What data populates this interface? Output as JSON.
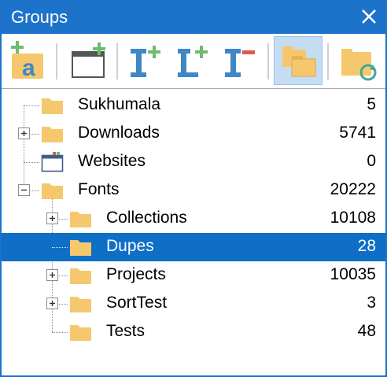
{
  "window": {
    "title": "Groups"
  },
  "toolbar": {
    "buttons": [
      {
        "name": "add-item-icon"
      },
      {
        "name": "new-folder-icon"
      },
      {
        "name": "insert-item-icon"
      },
      {
        "name": "insert-level-icon"
      },
      {
        "name": "remove-item-icon"
      },
      {
        "name": "group-folders-icon",
        "active": true
      },
      {
        "name": "refresh-folder-icon"
      }
    ]
  },
  "tree": {
    "rows": [
      {
        "label": "Sukhumala",
        "count": "5",
        "level": 0,
        "expander": "none",
        "icon": "folder"
      },
      {
        "label": "Downloads",
        "count": "5741",
        "level": 0,
        "expander": "plus",
        "icon": "folder"
      },
      {
        "label": "Websites",
        "count": "0",
        "level": 0,
        "expander": "none",
        "icon": "website"
      },
      {
        "label": "Fonts",
        "count": "20222",
        "level": 0,
        "expander": "minus",
        "icon": "folder"
      },
      {
        "label": "Collections",
        "count": "10108",
        "level": 1,
        "expander": "plus",
        "icon": "folder"
      },
      {
        "label": "Dupes",
        "count": "28",
        "level": 1,
        "expander": "none",
        "icon": "folder",
        "selected": true
      },
      {
        "label": "Projects",
        "count": "10035",
        "level": 1,
        "expander": "plus",
        "icon": "folder"
      },
      {
        "label": "SortTest",
        "count": "3",
        "level": 1,
        "expander": "plus",
        "icon": "folder"
      },
      {
        "label": "Tests",
        "count": "48",
        "level": 1,
        "expander": "none",
        "icon": "folder"
      }
    ]
  },
  "colors": {
    "titlebar": "#1d73c9",
    "selection": "#0f6fc6",
    "folder": "#f5c86e",
    "accent_green": "#6dbb6d",
    "accent_blue": "#3f87c5",
    "accent_red": "#e0584a"
  }
}
